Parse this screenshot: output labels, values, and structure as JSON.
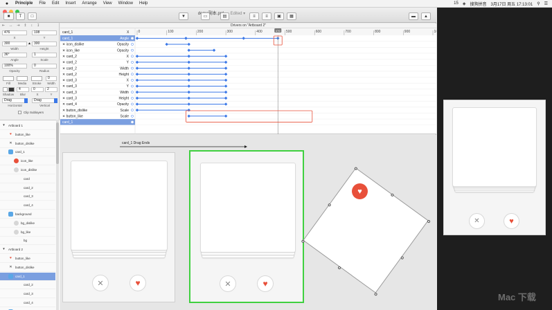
{
  "menubar": {
    "app_name": "Principle",
    "items": [
      "File",
      "Edit",
      "Insert",
      "Arrange",
      "View",
      "Window",
      "Help"
    ],
    "battery": "15",
    "input_method": "搜狗拼音",
    "datetime": "3月17日 周五  17:13:01"
  },
  "document": {
    "title": "demo副本.prd",
    "status": "— Edited ▾"
  },
  "properties": {
    "x": "476",
    "y": "108",
    "x_label": "X",
    "y_label": "Y",
    "width": "300",
    "height": "300",
    "width_label": "Width",
    "height_label": "Height",
    "angle": "36°",
    "scale": "1",
    "angle_label": "Angle",
    "scale_label": "Scale",
    "opacity": "100%",
    "radius": "0",
    "opacity_label": "Opacity",
    "radius_label": "Radius",
    "fill_label": "Fill",
    "media_label": "Media",
    "stroke_label": "Stroke",
    "width2_label": "Width",
    "shadow_label": "Shadow",
    "blur_label": "Blur",
    "sx_label": "X",
    "sy_label": "Y",
    "blur": "4",
    "sx": "0",
    "sy": "2",
    "horizontal": "Drag",
    "vertical": "Drag",
    "horizontal_label": "Horizontal",
    "vertical_label": "Vertical",
    "clip_label": "Clip Sublayers"
  },
  "layers": [
    {
      "label": "Artboard 1",
      "kind": "artboard"
    },
    {
      "label": "button_like",
      "kind": "heart"
    },
    {
      "label": "button_dislike",
      "kind": "x"
    },
    {
      "label": "card_1",
      "kind": "folder"
    },
    {
      "label": "icon_like",
      "kind": "likeicon"
    },
    {
      "label": "icon_dislike",
      "kind": "gray"
    },
    {
      "label": "card",
      "kind": "none"
    },
    {
      "label": "card_2",
      "kind": "none"
    },
    {
      "label": "card_3",
      "kind": "none"
    },
    {
      "label": "card_4",
      "kind": "none"
    },
    {
      "label": "background",
      "kind": "folder"
    },
    {
      "label": "bg_dislike",
      "kind": "gray"
    },
    {
      "label": "bg_like",
      "kind": "gray"
    },
    {
      "label": "bg",
      "kind": "none"
    },
    {
      "label": "Artboard 2",
      "kind": "artboard"
    },
    {
      "label": "button_like",
      "kind": "heart"
    },
    {
      "label": "button_dislike",
      "kind": "x"
    },
    {
      "label": "card_1",
      "kind": "selected"
    },
    {
      "label": "card_2",
      "kind": "none"
    },
    {
      "label": "card_3",
      "kind": "none"
    },
    {
      "label": "card_4",
      "kind": "none"
    },
    {
      "label": "background",
      "kind": "folder"
    }
  ],
  "timeline": {
    "title": "Drivers on \"Artboard 2\"",
    "header_layer": "card_1",
    "header_prop": "X",
    "ticks": [
      "0",
      "100",
      "200",
      "300",
      "400",
      "500",
      "600",
      "700",
      "800",
      "900",
      "1000"
    ],
    "playhead_label": "476",
    "rows": [
      {
        "layer": "card_1",
        "prop": "Angle",
        "start": 0,
        "end": 476,
        "mid": [
          165,
          360
        ],
        "selected": true
      },
      {
        "layer": "icon_dislike",
        "prop": "Opacity",
        "start": 100,
        "end": 175,
        "mid": []
      },
      {
        "layer": "icon_like",
        "prop": "Opacity",
        "start": 175,
        "end": 260,
        "mid": []
      },
      {
        "layer": "card_2",
        "prop": "X",
        "start": 0,
        "end": 300,
        "mid": [
          175
        ]
      },
      {
        "layer": "card_2",
        "prop": "Y",
        "start": 0,
        "end": 300,
        "mid": [
          175
        ]
      },
      {
        "layer": "card_2",
        "prop": "Width",
        "start": 0,
        "end": 300,
        "mid": [
          175
        ]
      },
      {
        "layer": "card_2",
        "prop": "Height",
        "start": 0,
        "end": 300,
        "mid": [
          175
        ]
      },
      {
        "layer": "card_3",
        "prop": "X",
        "start": 0,
        "end": 300,
        "mid": [
          175
        ]
      },
      {
        "layer": "card_3",
        "prop": "Y",
        "start": 0,
        "end": 300,
        "mid": [
          175
        ]
      },
      {
        "layer": "card_3",
        "prop": "Width",
        "start": 0,
        "end": 300,
        "mid": [
          175
        ]
      },
      {
        "layer": "card_3",
        "prop": "Height",
        "start": 0,
        "end": 300,
        "mid": [
          175
        ]
      },
      {
        "layer": "card_4",
        "prop": "Opacity",
        "start": 0,
        "end": 300,
        "mid": [
          175
        ]
      },
      {
        "layer": "button_dislike",
        "prop": "Scale",
        "start": 0,
        "end": 175,
        "mid": []
      },
      {
        "layer": "button_like",
        "prop": "Scale",
        "start": 175,
        "end": 300,
        "mid": []
      },
      {
        "layer": "card_1",
        "prop": "",
        "start": null,
        "end": null,
        "mid": [],
        "selected": true
      }
    ]
  },
  "canvas": {
    "drag_label": "card_1 Drag Ends",
    "accent_green": "#3fd03f",
    "accent_red": "#e8503a",
    "dislike_glyph": "✕",
    "like_glyph": "♥"
  },
  "watermark": "Mac 下载"
}
